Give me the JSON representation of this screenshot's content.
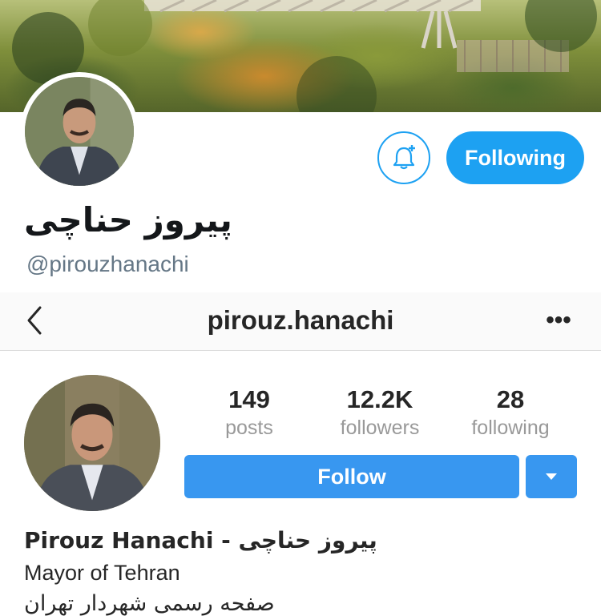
{
  "twitter": {
    "display_name": "پیروز حناچی",
    "handle": "@pirouzhanachi",
    "following_label": "Following"
  },
  "instagram": {
    "username": "pirouz.hanachi",
    "more_label": "•••",
    "stats": [
      {
        "value": "149",
        "label": "posts"
      },
      {
        "value": "12.2K",
        "label": "followers"
      },
      {
        "value": "28",
        "label": "following"
      }
    ],
    "follow_label": "Follow",
    "full_name": "Pirouz Hanachi - پیروز حناچی",
    "bio_line1": "Mayor of Tehran",
    "bio_line2": "صفحه رسمی شهردار تهران"
  },
  "colors": {
    "twitter_blue": "#1da1f2",
    "instagram_blue": "#3897f0"
  }
}
